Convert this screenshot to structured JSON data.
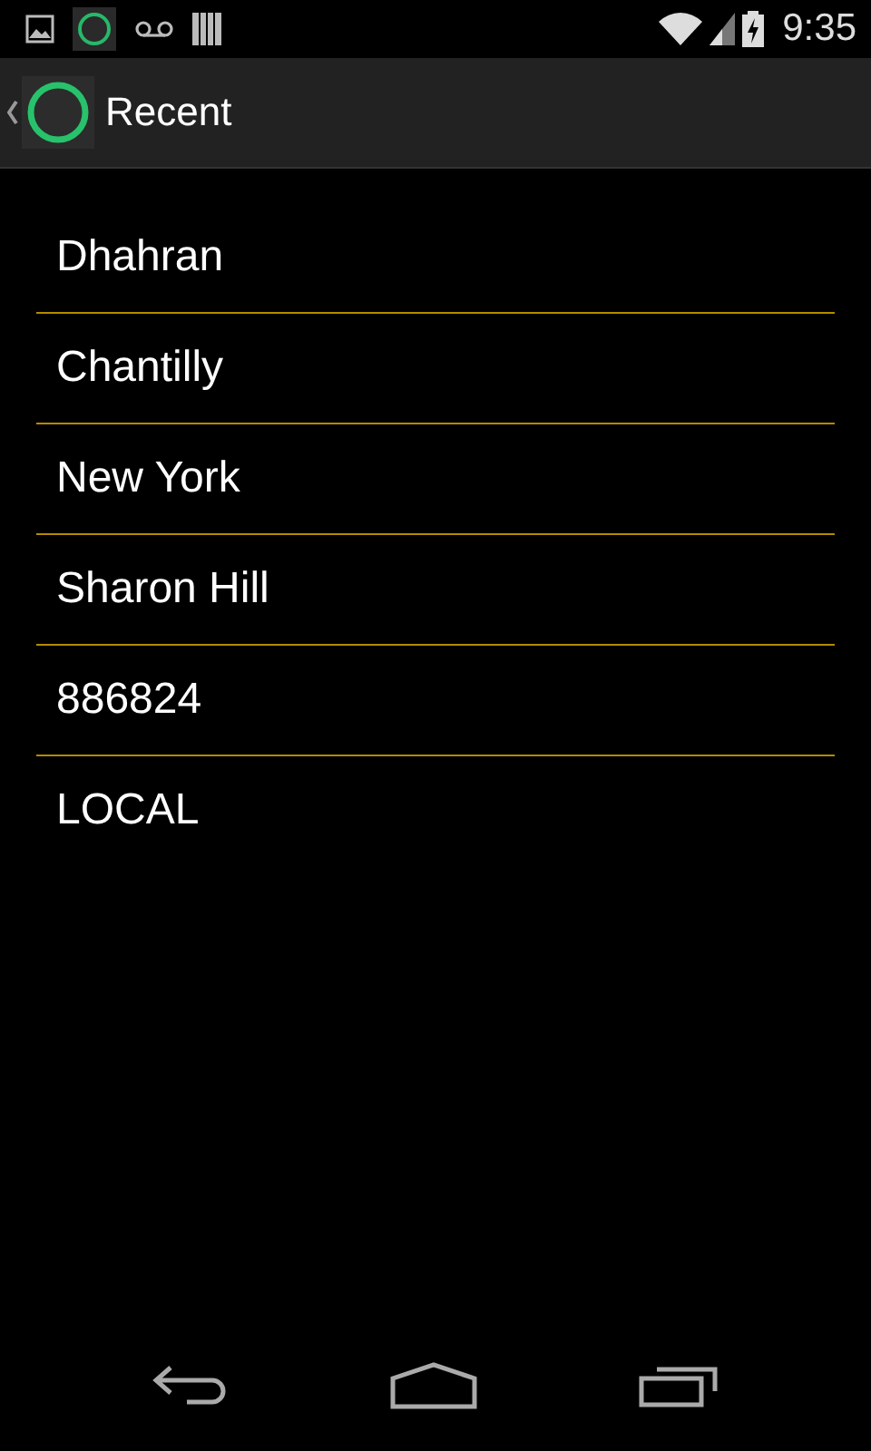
{
  "status_bar": {
    "time": "9:35"
  },
  "action_bar": {
    "title": "Recent"
  },
  "items": [
    {
      "label": "Dhahran"
    },
    {
      "label": "Chantilly"
    },
    {
      "label": "New York"
    },
    {
      "label": "Sharon Hill"
    },
    {
      "label": "886824"
    },
    {
      "label": "LOCAL"
    }
  ]
}
